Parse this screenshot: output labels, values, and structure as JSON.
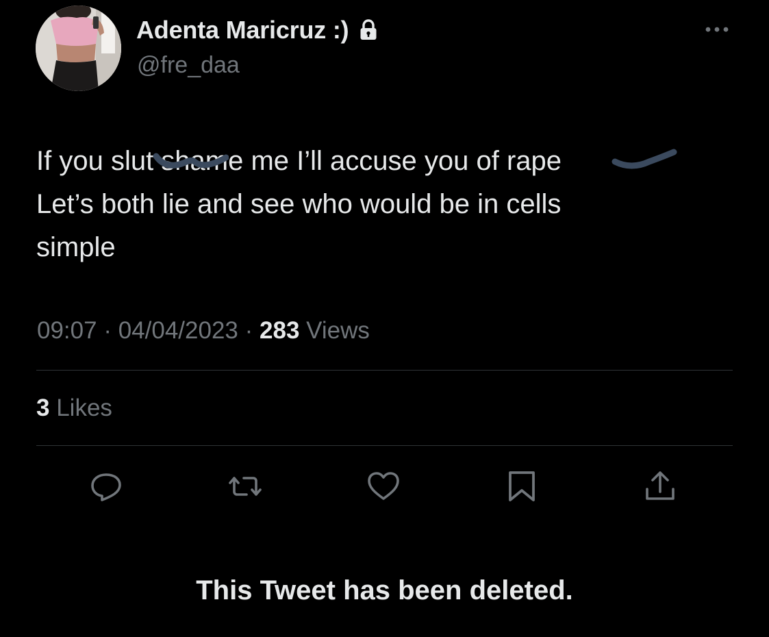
{
  "author": {
    "display_name": "Adenta Maricruz :)",
    "handle": "@fre_daa",
    "avatar_icon": "profile-photo",
    "lock_icon": "lock-icon"
  },
  "more_icon": "more-horizontal-icon",
  "tweet": {
    "text": "If you slut shame me I’ll accuse you of rape\nLet’s both lie and see who would be in cells\nsimple",
    "time": "09:07",
    "date": "04/04/2023",
    "separator": "·",
    "views_count": "283",
    "views_label": "Views",
    "likes_count": "3",
    "likes_label": "Likes"
  },
  "actions": [
    {
      "name": "reply",
      "icon": "reply-icon"
    },
    {
      "name": "retweet",
      "icon": "retweet-icon"
    },
    {
      "name": "like",
      "icon": "heart-icon"
    },
    {
      "name": "bookmark",
      "icon": "bookmark-icon"
    },
    {
      "name": "share",
      "icon": "share-icon"
    }
  ],
  "notice": {
    "deleted_text": "This Tweet has been deleted."
  },
  "colors": {
    "background": "#000000",
    "primary_text": "#e7e9ea",
    "secondary_text": "#71767b",
    "divider": "#2f3336",
    "redaction": "#3b4a5e"
  }
}
